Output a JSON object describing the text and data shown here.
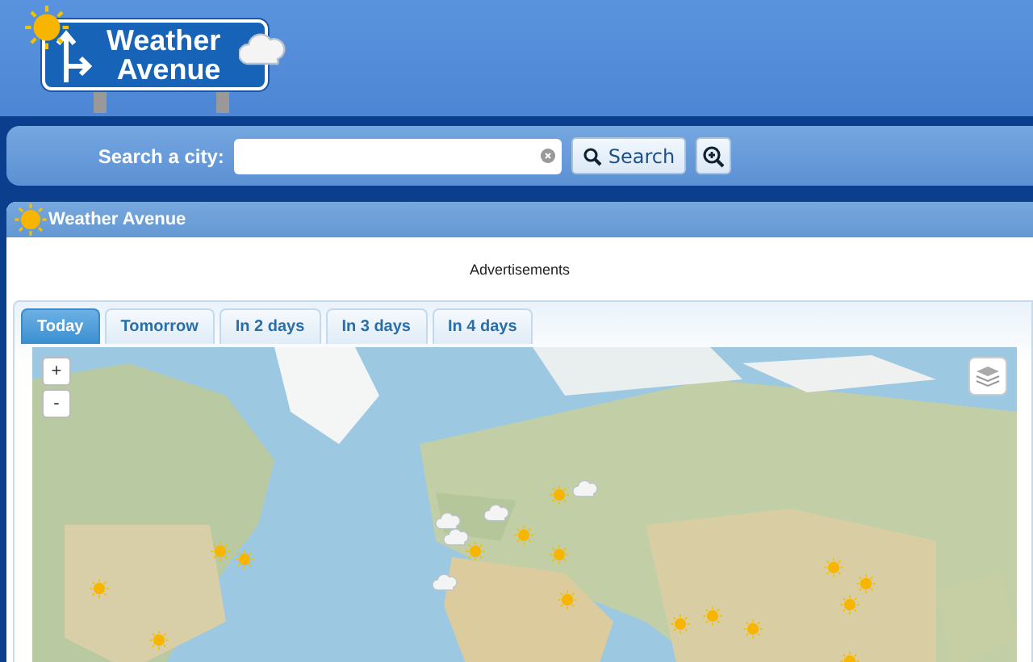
{
  "logo": {
    "lines": [
      "Weather",
      "Avenue"
    ]
  },
  "search": {
    "label": "Search a city:",
    "button": "Search"
  },
  "panel": {
    "title": "Weather Avenue",
    "ad_label": "Advertisements"
  },
  "tabs": [
    {
      "label": "Today",
      "selected": true
    },
    {
      "label": "Tomorrow",
      "selected": false
    },
    {
      "label": "In 2 days",
      "selected": false
    },
    {
      "label": "In 3 days",
      "selected": false
    },
    {
      "label": "In 4 days",
      "selected": false
    }
  ],
  "map": {
    "zoom_controls": [
      "+",
      "-"
    ]
  }
}
